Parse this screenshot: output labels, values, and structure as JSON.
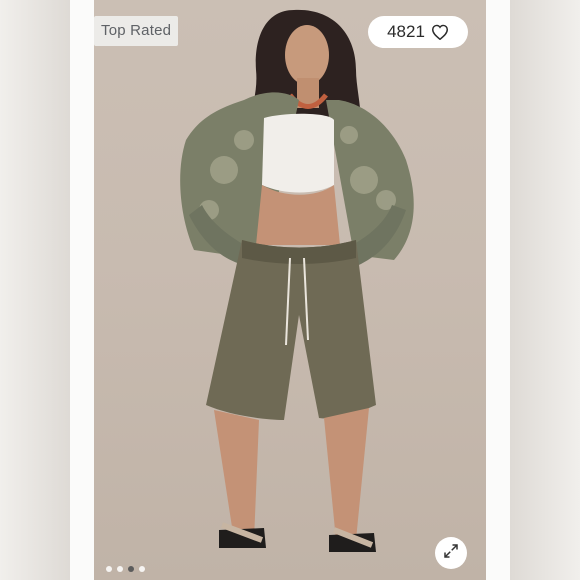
{
  "badge": {
    "label": "Top Rated"
  },
  "likes": {
    "count": "4821",
    "icon": "heart-outline-icon"
  },
  "carousel": {
    "total": 4,
    "active_index": 2
  },
  "expand": {
    "icon": "expand-arrows-icon"
  },
  "colors": {
    "background": "#e7e3de",
    "badge_bg": "#ecebe8",
    "badge_text": "#5f6266",
    "pill_bg": "#ffffff",
    "jacket": "#7b7f68",
    "shorts": "#6f6a55"
  }
}
